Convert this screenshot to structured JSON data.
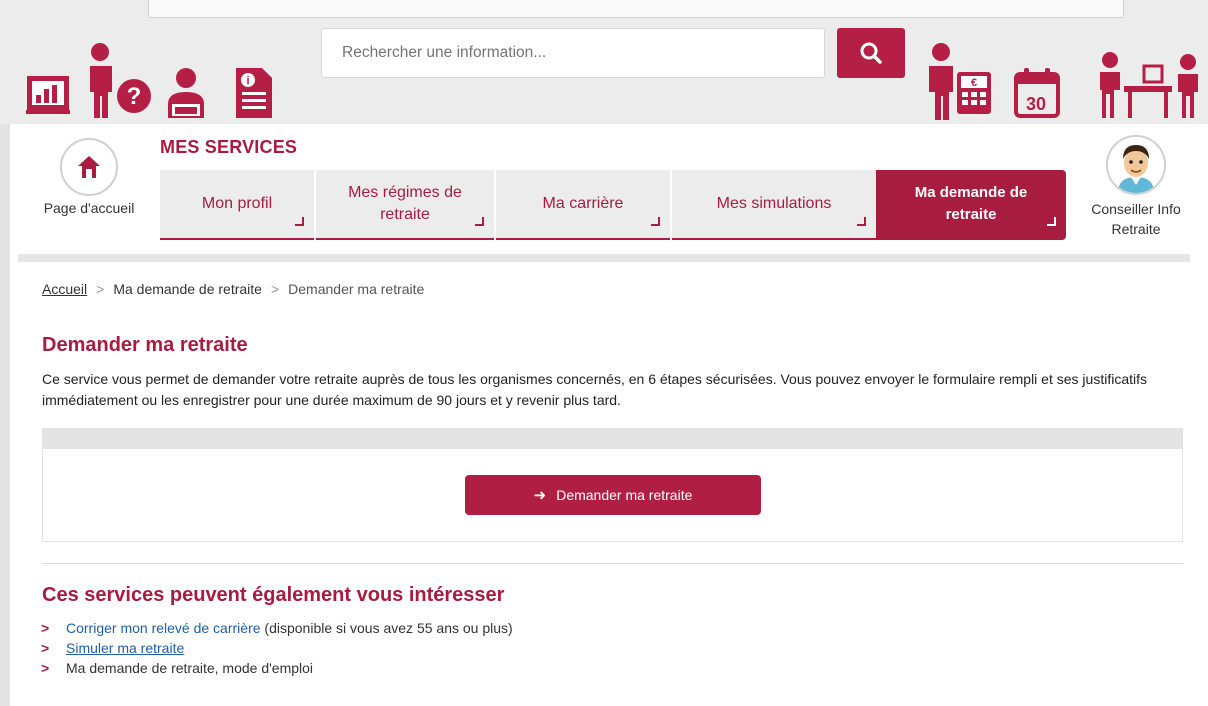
{
  "header": {
    "search": {
      "placeholder": "Rechercher une information..."
    },
    "left_icons": [
      "chart-board-icon",
      "question-person-icon",
      "advisor-woman-icon",
      "info-document-icon"
    ],
    "right_icons": [
      "person-calculator-icon",
      "calendar-30-icon",
      "people-desk-icon"
    ]
  },
  "nav": {
    "home_label": "Page d'accueil",
    "section_title": "MES SERVICES",
    "tabs": [
      {
        "label": "Mon profil"
      },
      {
        "label": "Mes régimes de retraite"
      },
      {
        "label": "Ma carrière"
      },
      {
        "label": "Mes simulations"
      },
      {
        "label": "Ma demande de retraite",
        "active": true
      }
    ],
    "advisor_label": "Conseiller Info Retraite"
  },
  "breadcrumb": {
    "home": "Accueil",
    "middle": "Ma demande de retraite",
    "current": "Demander ma retraite"
  },
  "main": {
    "title": "Demander ma retraite",
    "intro": "Ce service vous permet de demander votre retraite auprès de tous les organismes concernés, en 6 étapes sécurisées. Vous pouvez envoyer le formulaire rempli et ses justificatifs immédiatement ou les enregistrer pour une durée maximum de 90 jours et y revenir plus tard.",
    "cta_label": "Demander ma retraite"
  },
  "related": {
    "title": "Ces services peuvent également vous intéresser",
    "items": [
      {
        "link": "Corriger mon relevé de carrière",
        "note": " (disponible si vous avez 55 ans ou plus)"
      },
      {
        "link": "Simuler ma retraite"
      },
      {
        "text": "Ma demande de retraite, mode d'emploi"
      }
    ]
  },
  "colors": {
    "brand": "#a81c40",
    "link": "#1d5fa8",
    "header_bg": "#ececec"
  }
}
